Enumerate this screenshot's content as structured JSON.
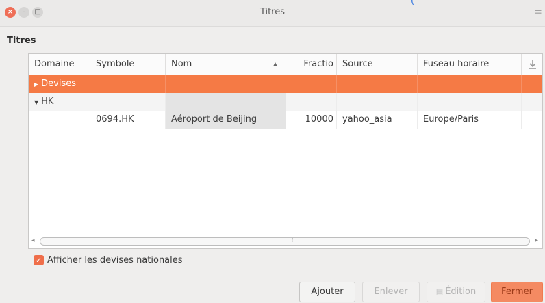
{
  "window": {
    "title": "Titres"
  },
  "section": {
    "title": "Titres"
  },
  "table": {
    "columns": [
      "Domaine",
      "Symbole",
      "Nom",
      "Fractio",
      "Source",
      "Fuseau horaire"
    ],
    "sort_indicator": "▲",
    "column_chooser_icon": "column-chooser-icon",
    "groups": [
      {
        "label": "Devises",
        "expanded": false,
        "selected": true
      },
      {
        "label": "HK",
        "expanded": true,
        "selected": false
      }
    ],
    "rows": [
      {
        "domaine": "",
        "symbole": "0694.HK",
        "nom": "Aéroport de Beijing",
        "fraction": "10000",
        "source": "yahoo_asia",
        "fuseau": "Europe/Paris"
      }
    ]
  },
  "options": {
    "show_national_currencies": {
      "label": "Afficher les devises nationales",
      "checked": true
    }
  },
  "buttons": {
    "add": "Ajouter",
    "remove": "Enlever",
    "edit": "Édition",
    "close": "Fermer"
  },
  "colors": {
    "accent": "#f57a45",
    "selection": "#f57a45"
  }
}
